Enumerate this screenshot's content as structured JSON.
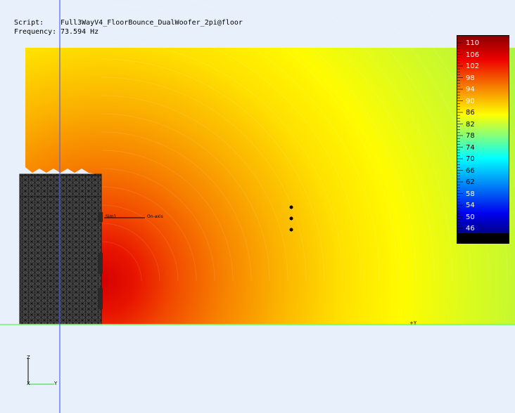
{
  "header": {
    "script_label": "Script:",
    "script_value": "Full3WayV4_FloorBounce_DualWoofer_2pi@floor",
    "freq_label": "Frequency:",
    "freq_value": "73.594 Hz"
  },
  "legend": {
    "ticks": [
      "110",
      "106",
      "102",
      "98",
      "94",
      "90",
      "86",
      "82",
      "78",
      "74",
      "70",
      "66",
      "62",
      "58",
      "54",
      "50",
      "46"
    ],
    "range": [
      46,
      110
    ],
    "colors": {
      "top": "#8b0000",
      "red": "#ee0000",
      "yellow": "#ffff00",
      "cyan": "#00ffff",
      "blue": "#0000ee",
      "bottom": "#00008b"
    }
  },
  "annotations": {
    "mic_label": "Sim1",
    "onaxis_label": "On-axis",
    "y_axis_marker": "+Y",
    "triad_z": "Z",
    "triad_x": "X",
    "triad_y": "Y"
  },
  "colors": {
    "background": "#e8f1fb",
    "cabinet": "#4a4a4a",
    "floor_line": "#66ff66",
    "axis_line": "#5060ff"
  }
}
